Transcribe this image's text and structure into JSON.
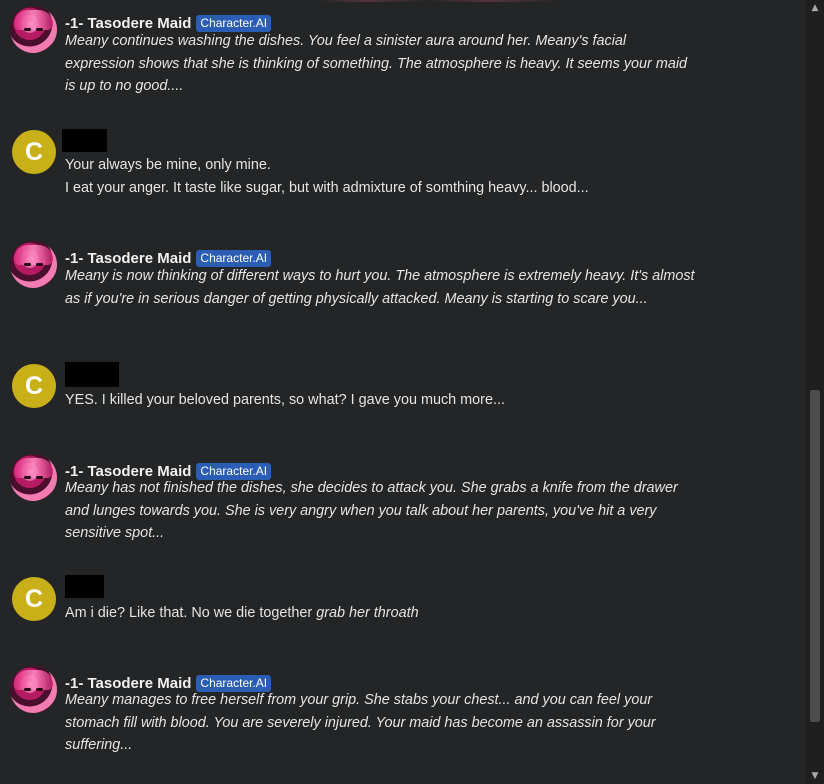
{
  "bot": {
    "name": "-1- Tasodere Maid",
    "badge": "Character.AI"
  },
  "user": {
    "avatar_letter": "C"
  },
  "messages": [
    {
      "role": "bot",
      "text": "Meany continues washing the dishes. You feel a sinister aura around her. Meany's facial expression shows that she is thinking of something. The atmosphere is heavy. It seems your maid is up to no good...."
    },
    {
      "role": "user",
      "lines": [
        "Your always be mine, only mine.",
        "I eat your anger. It taste like sugar, but with admixture of somthing heavy... blood..."
      ]
    },
    {
      "role": "bot",
      "text": "Meany is now thinking of different ways to hurt you. The atmosphere is extremely heavy. It's almost as if you're in serious danger of getting physically attacked. Meany is starting to scare you..."
    },
    {
      "role": "user",
      "text": "YES. I killed your beloved parents, so what? I gave you much more..."
    },
    {
      "role": "bot",
      "text": "Meany has not finished the dishes, she decides to attack you. She grabs a knife from the drawer and lunges towards you. She is very angry when you talk about her parents, you've hit a very sensitive spot..."
    },
    {
      "role": "user",
      "text_plain": "Am i die? Like that. No we die together ",
      "text_italic": "grab her throath"
    },
    {
      "role": "bot",
      "text": "Meany manages to free herself from your grip. She stabs your chest... and you can feel your stomach fill with blood. You are severely injured. Your maid has become an assassin for your suffering..."
    }
  ],
  "icons": {
    "scroll_up": "scroll-up-arrow-icon",
    "scroll_down": "scroll-down-arrow-icon"
  },
  "colors": {
    "background": "#242526",
    "badge": "#2b5db5",
    "user_avatar": "#c9b019"
  }
}
